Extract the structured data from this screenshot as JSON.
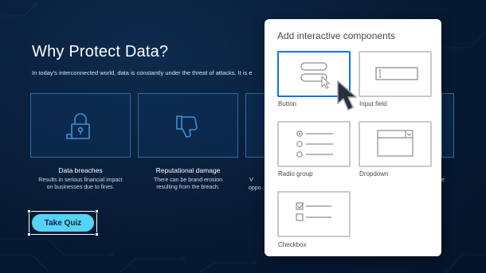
{
  "slide": {
    "title": "Why Protect Data?",
    "subtitle": "In today's interconnected world, data is constantly under the threat of attacks. It is e",
    "cards": [
      {
        "title": "Data breaches",
        "desc": [
          "Results in serious financial impact",
          "on businesses due to fines."
        ],
        "icon": "padlock-icon"
      },
      {
        "title": "Reputational damage",
        "desc": [
          "There can be brand erosion",
          "resulting from the breach."
        ],
        "icon": "thumbs-down-icon"
      }
    ],
    "partial_texts": [
      "V",
      "oppo",
      "e"
    ],
    "quiz_button": "Take Quiz"
  },
  "panel": {
    "title": "Add interactive components",
    "items": [
      {
        "label": "Button",
        "icon": "button-component-icon",
        "selected": true
      },
      {
        "label": "Input field",
        "icon": "input-field-component-icon",
        "selected": false
      },
      {
        "label": "Radio group",
        "icon": "radio-group-component-icon",
        "selected": false
      },
      {
        "label": "Dropdown",
        "icon": "dropdown-component-icon",
        "selected": false
      },
      {
        "label": "Checkbox",
        "icon": "checkbox-component-icon",
        "selected": false
      }
    ]
  },
  "colors": {
    "slide_bg": "#071a33",
    "card_border": "#2e6aa0",
    "quiz_button": "#55d3f5",
    "selected_accent": "#1473e6",
    "tile_border": "#c9c9c9"
  }
}
